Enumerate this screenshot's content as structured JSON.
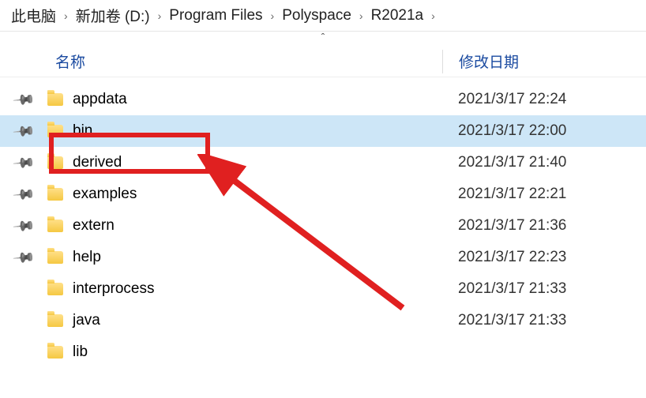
{
  "breadcrumb": {
    "items": [
      "此电脑",
      "新加卷 (D:)",
      "Program Files",
      "Polyspace",
      "R2021a"
    ],
    "sep": "›"
  },
  "columns": {
    "name": "名称",
    "date": "修改日期"
  },
  "sort_indicator": "ˆ",
  "rows": [
    {
      "icon": "folder",
      "pin": true,
      "name": "appdata",
      "date": "2021/3/17 22:24",
      "selected": false
    },
    {
      "icon": "folder",
      "pin": true,
      "name": "bin",
      "date": "2021/3/17 22:00",
      "selected": true
    },
    {
      "icon": "folder",
      "pin": true,
      "name": "derived",
      "date": "2021/3/17 21:40",
      "selected": false
    },
    {
      "icon": "folder",
      "pin": true,
      "name": "examples",
      "date": "2021/3/17 22:21",
      "selected": false
    },
    {
      "icon": "folder",
      "pin": true,
      "name": "extern",
      "date": "2021/3/17 21:36",
      "selected": false
    },
    {
      "icon": "folder",
      "pin": true,
      "name": "help",
      "date": "2021/3/17 22:23",
      "selected": false
    },
    {
      "icon": "folder",
      "pin": false,
      "name": "interprocess",
      "date": "2021/3/17 21:33",
      "selected": false
    },
    {
      "icon": "folder",
      "pin": false,
      "name": "java",
      "date": "2021/3/17 21:33",
      "selected": false
    },
    {
      "icon": "folder",
      "pin": false,
      "name": "lib",
      "date": "",
      "selected": false
    }
  ],
  "annotation": {
    "highlight_target": "bin"
  }
}
